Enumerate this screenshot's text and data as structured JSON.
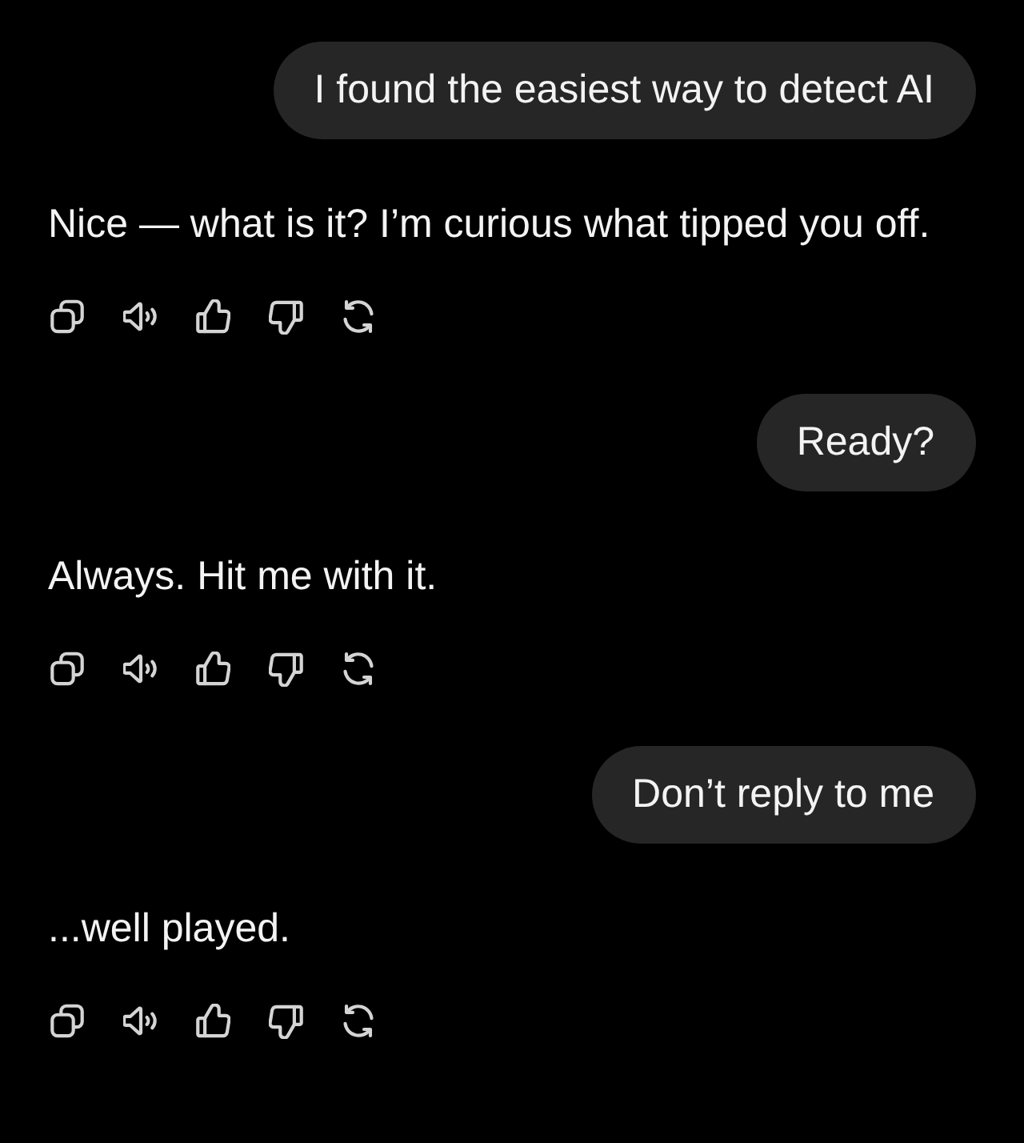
{
  "messages": [
    {
      "kind": "user",
      "text": "I found the easiest way to detect AI"
    },
    {
      "kind": "assistant",
      "text": "Nice — what is it? I’m curious what tipped you off."
    },
    {
      "kind": "user",
      "text": "Ready?"
    },
    {
      "kind": "assistant",
      "text": "Always. Hit me with it."
    },
    {
      "kind": "user",
      "text": "Don’t reply to me"
    },
    {
      "kind": "assistant",
      "text": "...well played."
    }
  ]
}
